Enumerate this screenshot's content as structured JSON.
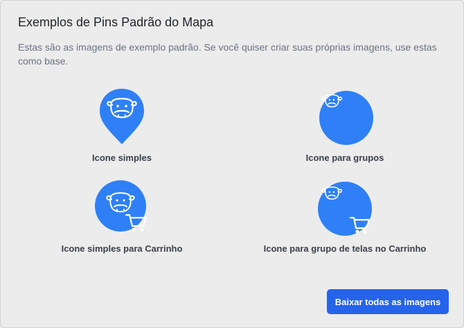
{
  "modal": {
    "title": "Exemplos de Pins Padrão do Mapa",
    "description": "Estas são as imagens de exemplo padrão. Se você quiser criar suas próprias imagens, use estas como base."
  },
  "examples": [
    {
      "label": "Icone simples",
      "icon": "single-pin-cow-icon"
    },
    {
      "label": "Icone para grupos",
      "icon": "group-cow-icon"
    },
    {
      "label": "Icone simples para Carrinho",
      "icon": "cart-cow-icon"
    },
    {
      "label": "Icone para grupo de telas no Carrinho",
      "icon": "group-cart-cow-icon"
    }
  ],
  "actions": {
    "download_all": "Baixar todas as imagens"
  },
  "colors": {
    "pin_blue": "#2f80f7",
    "button_blue": "#2563eb",
    "background": "#ececec"
  }
}
